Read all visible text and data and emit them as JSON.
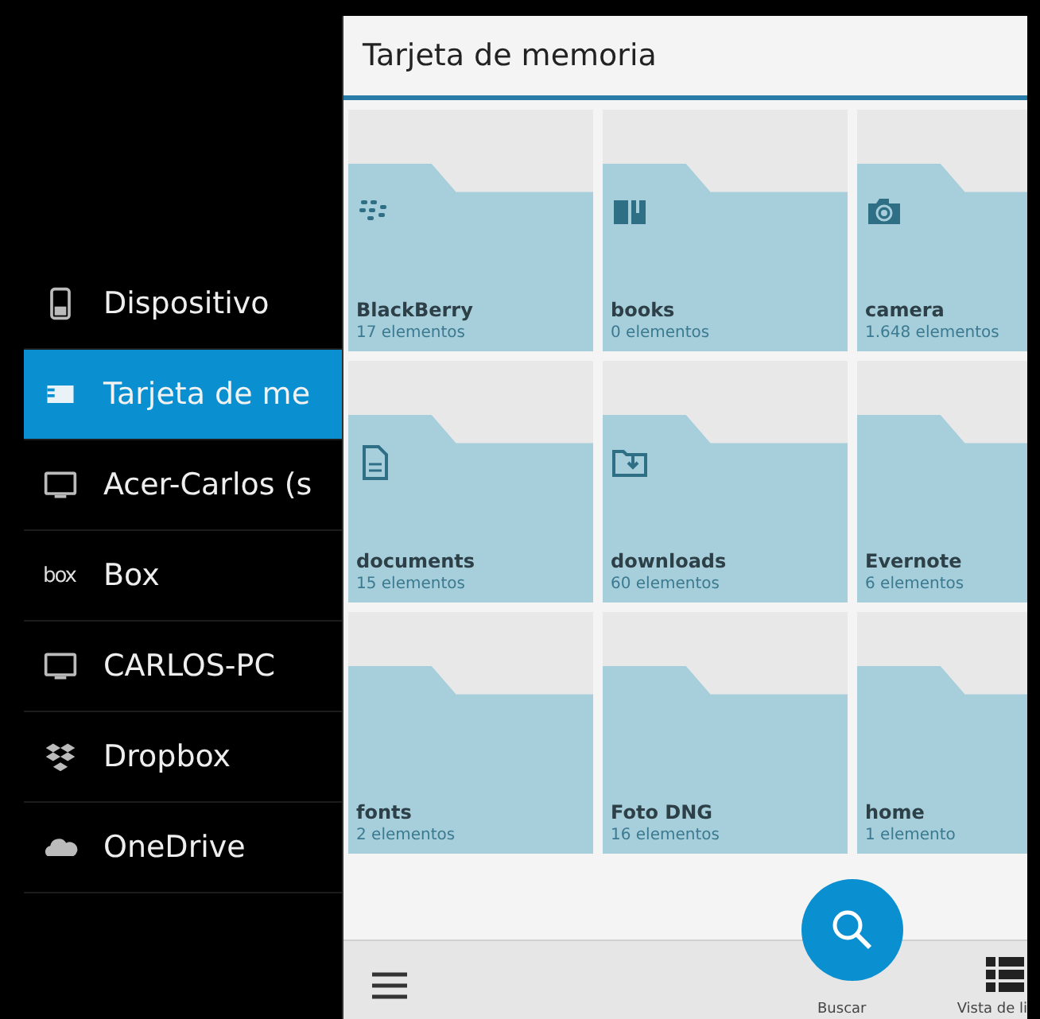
{
  "sidebar": {
    "items": [
      {
        "label": "Dispositivo",
        "kind": "phone",
        "selected": false
      },
      {
        "label": "Tarjeta de me",
        "kind": "sdcard",
        "selected": true
      },
      {
        "label": "Acer-Carlos (s",
        "kind": "monitor",
        "selected": false
      },
      {
        "label": "Box",
        "kind": "box",
        "logo_text": "box",
        "selected": false
      },
      {
        "label": "CARLOS-PC",
        "kind": "monitor",
        "selected": false
      },
      {
        "label": "Dropbox",
        "kind": "dropbox",
        "selected": false
      },
      {
        "label": "OneDrive",
        "kind": "cloud",
        "selected": false
      }
    ]
  },
  "header": {
    "title": "Tarjeta de memoria"
  },
  "folders": [
    {
      "name": "BlackBerry",
      "count": "17 elementos",
      "kind": "blackberry"
    },
    {
      "name": "books",
      "count": "0 elementos",
      "kind": "book"
    },
    {
      "name": "camera",
      "count": "1.648 elementos",
      "kind": "camera"
    },
    {
      "name": "documents",
      "count": "15 elementos",
      "kind": "document"
    },
    {
      "name": "downloads",
      "count": "60 elementos",
      "kind": "download"
    },
    {
      "name": "Evernote",
      "count": "6 elementos",
      "kind": "plain"
    },
    {
      "name": "fonts",
      "count": "2 elementos",
      "kind": "plain"
    },
    {
      "name": "Foto DNG",
      "count": "16 elementos",
      "kind": "plain"
    },
    {
      "name": "home",
      "count": "1 elemento",
      "kind": "plain"
    }
  ],
  "action_bar": {
    "search_label": "Buscar",
    "view_label": "Vista de li"
  }
}
